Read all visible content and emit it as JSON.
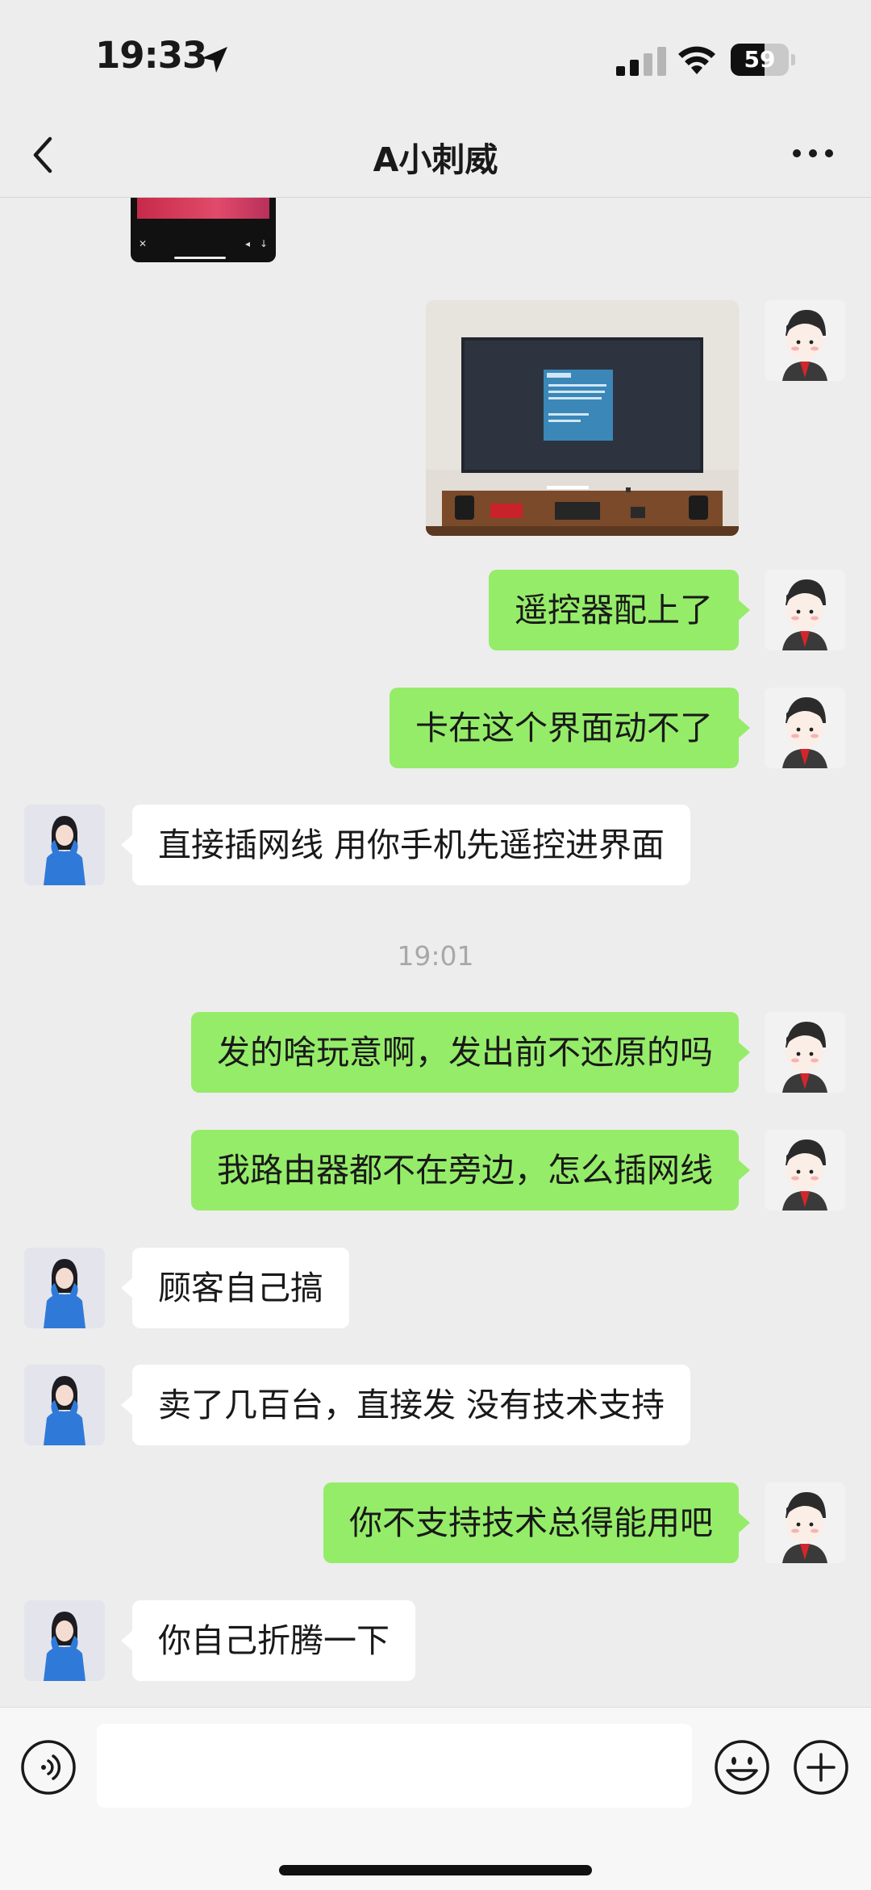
{
  "status_bar": {
    "time": "19:33",
    "battery": "59",
    "battery_level": 0.59
  },
  "nav": {
    "title": "A小刺威"
  },
  "messages": [
    {
      "side": "me",
      "text": "遥控器配上了"
    },
    {
      "side": "me",
      "text": "卡在这个界面动不了"
    },
    {
      "side": "other",
      "text": "直接插网线 用你手机先遥控进界面"
    },
    {
      "side": "me",
      "text": "发的啥玩意啊，发出前不还原的吗"
    },
    {
      "side": "me",
      "text": "我路由器都不在旁边，怎么插网线"
    },
    {
      "side": "other",
      "text": "顾客自己搞"
    },
    {
      "side": "other",
      "text": "卖了几百台，直接发 没有技术支持"
    },
    {
      "side": "me",
      "text": "你不支持技术总得能用吧"
    },
    {
      "side": "other",
      "text": "你自己折腾一下"
    }
  ],
  "timestamp": "19:01",
  "colors": {
    "my_bubble": "#95ec69",
    "other_bubble": "#ffffff",
    "background": "#ededed"
  },
  "icons": [
    "back-arrow-icon",
    "more-icon",
    "voice-icon",
    "emoji-icon",
    "plus-icon",
    "location-arrow-icon",
    "signal-icon",
    "wifi-icon"
  ]
}
